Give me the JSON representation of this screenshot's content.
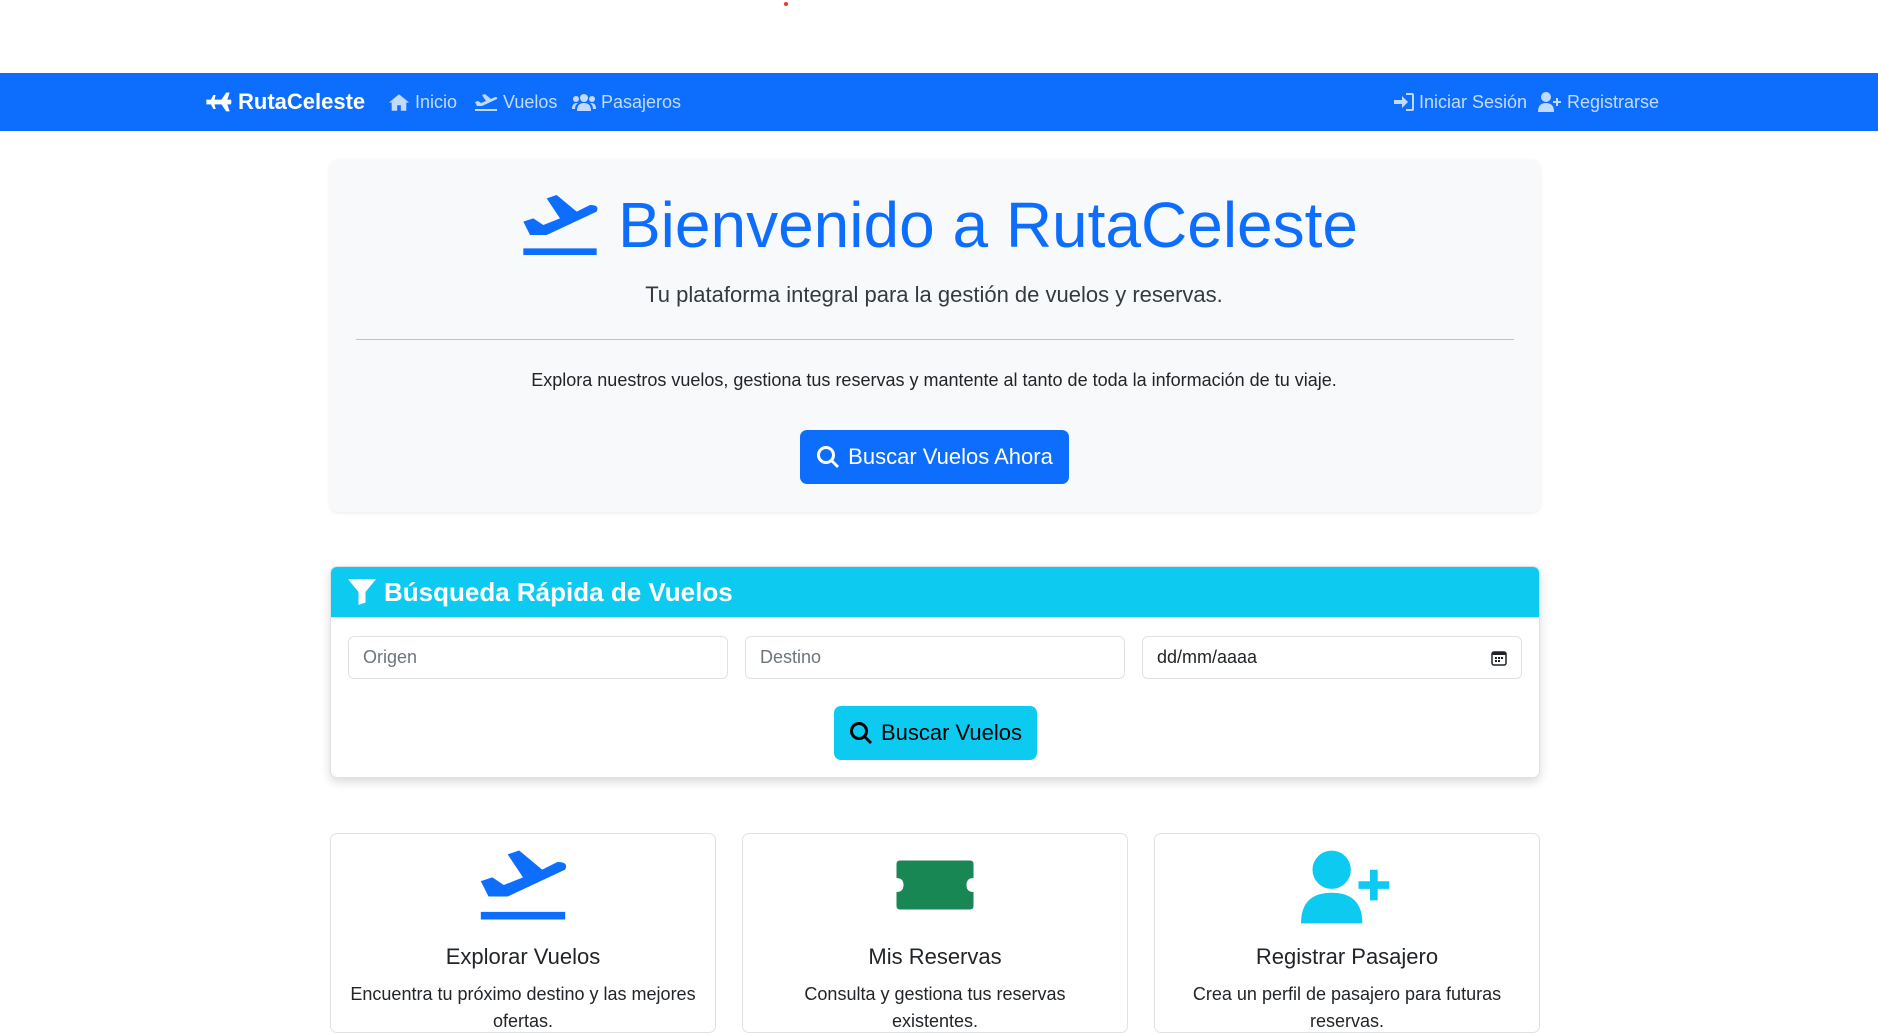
{
  "nav": {
    "brand": "RutaCeleste",
    "links": [
      {
        "label": "Inicio",
        "icon": "home-icon"
      },
      {
        "label": "Vuelos",
        "icon": "plane-departure-icon"
      },
      {
        "label": "Pasajeros",
        "icon": "users-icon"
      }
    ],
    "right_links": [
      {
        "label": "Iniciar Sesión",
        "icon": "sign-in-icon"
      },
      {
        "label": "Registrarse",
        "icon": "user-plus-icon"
      }
    ]
  },
  "hero": {
    "title": "Bienvenido a RutaCeleste",
    "subtitle": "Tu plataforma integral para la gestión de vuelos y reservas.",
    "description": "Explora nuestros vuelos, gestiona tus reservas y mantente al tanto de toda la información de tu viaje.",
    "button_label": "Buscar Vuelos Ahora"
  },
  "quick_search": {
    "title": "Búsqueda Rápida de Vuelos",
    "origin_placeholder": "Origen",
    "destination_placeholder": "Destino",
    "date_value": "dd/mm/aaaa",
    "button_label": "Buscar Vuelos"
  },
  "features": [
    {
      "title": "Explorar Vuelos",
      "description": "Encuentra tu próximo destino y las mejores ofertas.",
      "icon": "plane-departure-icon",
      "color": "#0d6efd"
    },
    {
      "title": "Mis Reservas",
      "description": "Consulta y gestiona tus reservas existentes.",
      "icon": "ticket-icon",
      "color": "#198754"
    },
    {
      "title": "Registrar Pasajero",
      "description": "Crea un perfil de pasajero para futuras reservas.",
      "icon": "user-plus-icon",
      "color": "#0dcaf0"
    }
  ],
  "colors": {
    "primary": "#0d6efd",
    "info": "#0dcaf0",
    "success": "#198754",
    "hero_bg": "#f8f9fa"
  }
}
